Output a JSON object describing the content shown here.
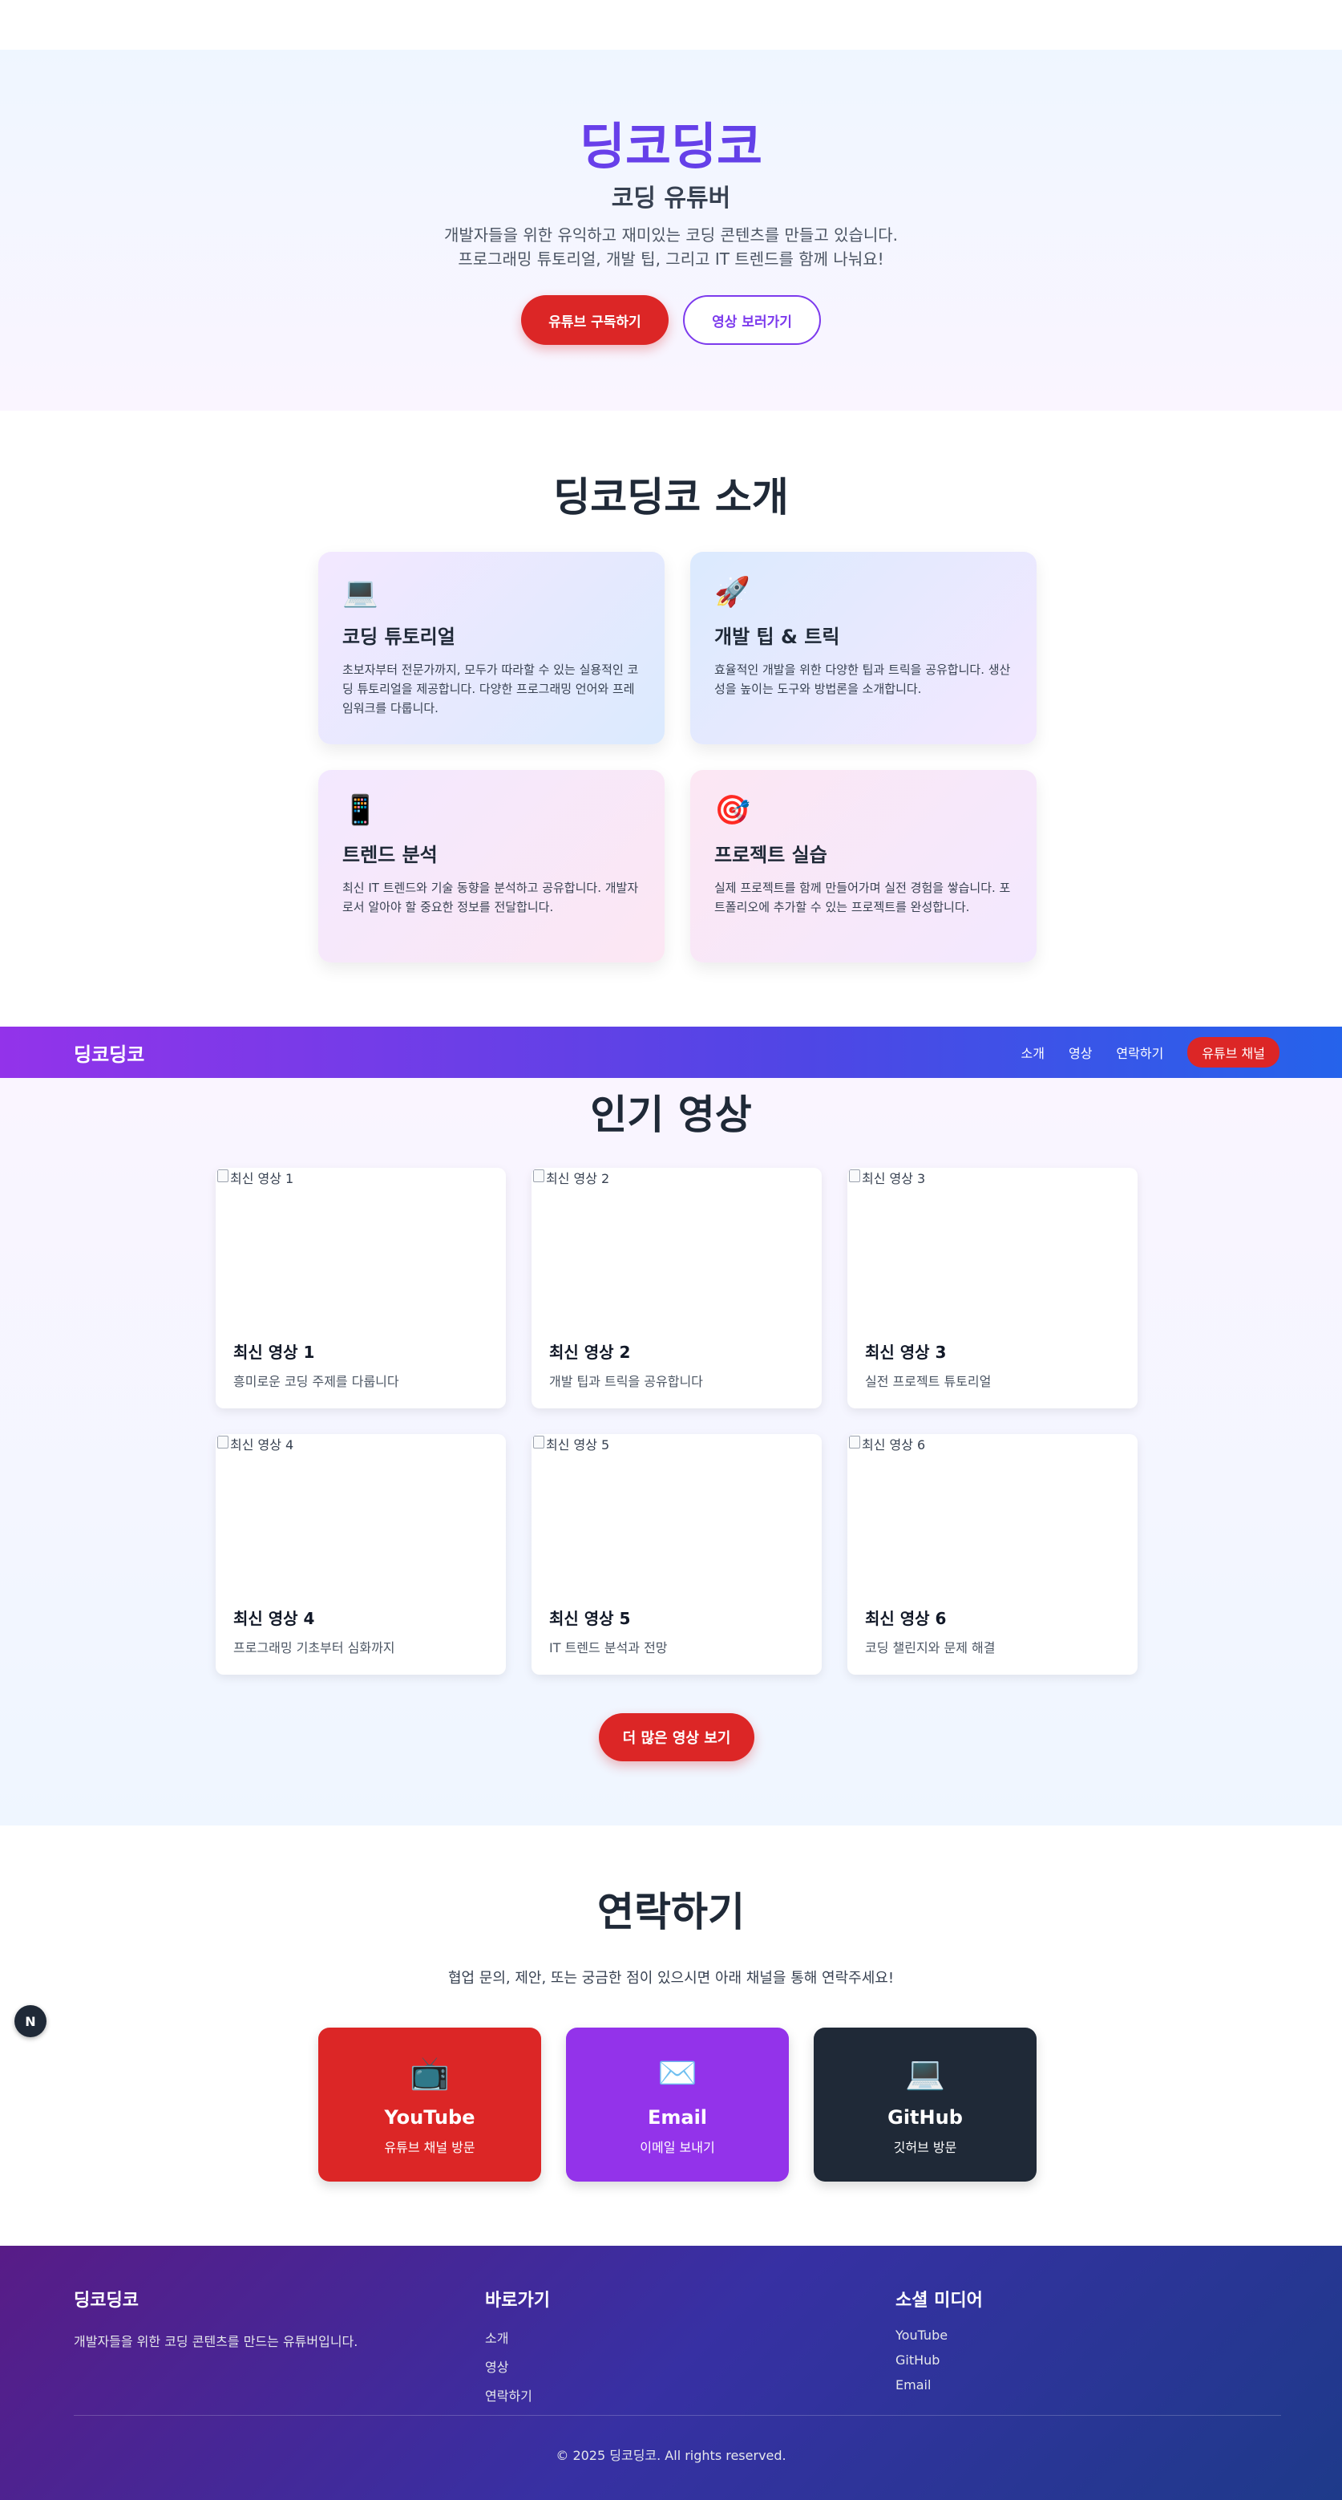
{
  "hero": {
    "title": "딩코딩코",
    "subtitle": "코딩 유튜버",
    "desc_line1": "개발자들을 위한 유익하고 재미있는 코딩 콘텐츠를 만들고 있습니다.",
    "desc_line2": "프로그래밍 튜토리얼, 개발 팁, 그리고 IT 트렌드를 함께 나눠요!",
    "subscribe_label": "유튜브 구독하기",
    "watch_label": "영상 보러가기"
  },
  "about": {
    "title": "딩코딩코 소개",
    "cards": [
      {
        "icon": "💻",
        "title": "코딩 튜토리얼",
        "desc": "초보자부터 전문가까지, 모두가 따라할 수 있는 실용적인 코딩 튜토리얼을 제공합니다. 다양한 프로그래밍 언어와 프레임워크를 다룹니다."
      },
      {
        "icon": "🚀",
        "title": "개발 팁 & 트릭",
        "desc": "효율적인 개발을 위한 다양한 팁과 트릭을 공유합니다. 생산성을 높이는 도구와 방법론을 소개합니다."
      },
      {
        "icon": "📱",
        "title": "트렌드 분석",
        "desc": "최신 IT 트렌드와 기술 동향을 분석하고 공유합니다. 개발자로서 알아야 할 중요한 정보를 전달합니다."
      },
      {
        "icon": "🎯",
        "title": "프로젝트 실습",
        "desc": "실제 프로젝트를 함께 만들어가며 실전 경험을 쌓습니다. 포트폴리오에 추가할 수 있는 프로젝트를 완성합니다."
      }
    ]
  },
  "nav": {
    "logo": "딩코딩코",
    "links": [
      "소개",
      "영상",
      "연락하기"
    ],
    "cta": "유튜브 채널"
  },
  "videos": {
    "title": "인기 영상",
    "items": [
      {
        "alt": "최신 영상 1",
        "title": "최신 영상 1",
        "desc": "흥미로운 코딩 주제를 다룹니다"
      },
      {
        "alt": "최신 영상 2",
        "title": "최신 영상 2",
        "desc": "개발 팁과 트릭을 공유합니다"
      },
      {
        "alt": "최신 영상 3",
        "title": "최신 영상 3",
        "desc": "실전 프로젝트 튜토리얼"
      },
      {
        "alt": "최신 영상 4",
        "title": "최신 영상 4",
        "desc": "프로그래밍 기초부터 심화까지"
      },
      {
        "alt": "최신 영상 5",
        "title": "최신 영상 5",
        "desc": "IT 트렌드 분석과 전망"
      },
      {
        "alt": "최신 영상 6",
        "title": "최신 영상 6",
        "desc": "코딩 챌린지와 문제 해결"
      }
    ],
    "more_label": "더 많은 영상 보기"
  },
  "contact": {
    "title": "연락하기",
    "desc": "협업 문의, 제안, 또는 궁금한 점이 있으시면 아래 채널을 통해 연락주세요!",
    "cards": [
      {
        "icon": "📺",
        "name": "YouTube",
        "sub": "유튜브 채널 방문"
      },
      {
        "icon": "✉️",
        "name": "Email",
        "sub": "이메일 보내기"
      },
      {
        "icon": "💻",
        "name": "GitHub",
        "sub": "깃허브 방문"
      }
    ]
  },
  "floating_badge": "N",
  "footer": {
    "brand": "딩코딩코",
    "brand_desc": "개발자들을 위한 코딩 콘텐츠를 만드는 유튜버입니다.",
    "links_title": "바로가기",
    "links": [
      "소개",
      "영상",
      "연락하기"
    ],
    "social_title": "소셜 미디어",
    "social": [
      "YouTube",
      "GitHub",
      "Email"
    ],
    "copyright": "© 2025 딩코딩코. All rights reserved."
  }
}
